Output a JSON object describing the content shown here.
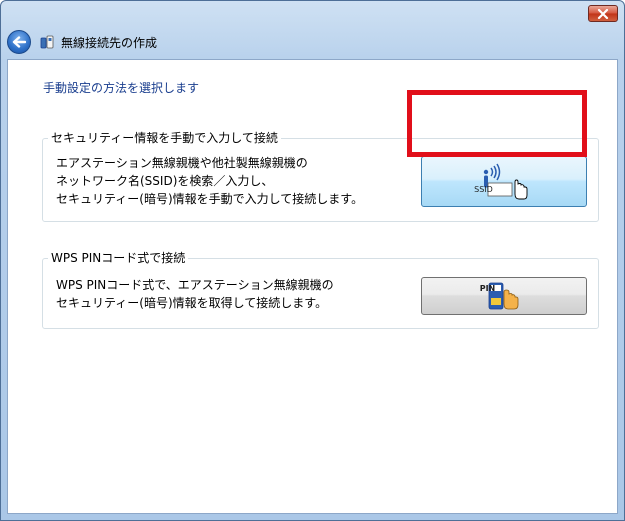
{
  "window": {
    "title": "無線接続先の作成"
  },
  "instruction": "手動設定の方法を選択します",
  "options": [
    {
      "legend": "セキュリティー情報を手動で入力して接続",
      "lines": [
        "エアステーション無線親機や他社製無線親機の",
        "ネットワーク名(SSID)を検索／入力し、",
        "セキュリティー(暗号)情報を手動で入力して接続します。"
      ],
      "button_icon_text": "SSID",
      "state": "hover"
    },
    {
      "legend": "WPS PINコード式で接続",
      "lines": [
        "WPS PINコード式で、エアステーション無線親機の",
        "セキュリティー(暗号)情報を取得して接続します。"
      ],
      "button_icon_text": "PIN",
      "state": "normal"
    }
  ],
  "icons": {
    "close": "close-icon",
    "back": "back-arrow-icon",
    "title": "wireless-network-icon",
    "ssid_button": "ssid-hand-icon",
    "pin_button": "pin-hand-icon"
  },
  "colors": {
    "highlight": "#e10f1a",
    "instruction_text": "#1b3f8f",
    "hover_button": "#bee6fd"
  }
}
